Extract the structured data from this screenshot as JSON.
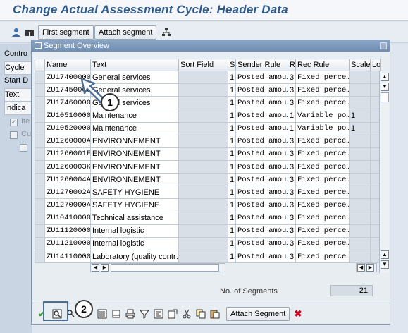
{
  "window": {
    "title": "Change Actual Assessment Cycle: Header Data"
  },
  "toolbar": {
    "icons": [
      "person-icon",
      "binoculars-icon"
    ],
    "first_segment_label": "First segment",
    "attach_segment_label": "Attach segment",
    "last_icon": "hierarchy-icon"
  },
  "left_panel": {
    "items": [
      "Contro",
      "Cycle",
      "Start D",
      "Text"
    ],
    "active_tab": "Indica",
    "checkbox_labels": [
      "Ite",
      "Cu"
    ]
  },
  "dialog": {
    "title": "Segment Overview",
    "columns": [
      "Name",
      "Text",
      "Sort Field",
      "S",
      "Sender Rule",
      "R",
      "Rec Rule",
      "Scale",
      "Lo"
    ],
    "rows": [
      {
        "name": "ZU17400000",
        "text": "General services",
        "sort": "",
        "s": "1",
        "sender_rule": "Posted amou…",
        "r": "3",
        "rec_rule": "Fixed perce…",
        "scale": ""
      },
      {
        "name": "ZU17450000",
        "text": "General services",
        "sort": "",
        "s": "1",
        "sender_rule": "Posted amou…",
        "r": "3",
        "rec_rule": "Fixed perce…",
        "scale": ""
      },
      {
        "name": "ZU17460000",
        "text": "General services",
        "sort": "",
        "s": "1",
        "sender_rule": "Posted amou…",
        "r": "3",
        "rec_rule": "Fixed perce…",
        "scale": ""
      },
      {
        "name": "ZU10510000",
        "text": "Maintenance",
        "sort": "",
        "s": "1",
        "sender_rule": "Posted amou…",
        "r": "1",
        "rec_rule": "Variable po…",
        "scale": "1"
      },
      {
        "name": "ZU10520000",
        "text": "Maintenance",
        "sort": "",
        "s": "1",
        "sender_rule": "Posted amou…",
        "r": "1",
        "rec_rule": "Variable po…",
        "scale": "1"
      },
      {
        "name": "ZU1260000A",
        "text": "ENVIRONNEMENT",
        "sort": "",
        "s": "1",
        "sender_rule": "Posted amou…",
        "r": "3",
        "rec_rule": "Fixed perce…",
        "scale": ""
      },
      {
        "name": "ZU1260001F",
        "text": "ENVIRONNEMENT",
        "sort": "",
        "s": "1",
        "sender_rule": "Posted amou…",
        "r": "3",
        "rec_rule": "Fixed perce…",
        "scale": ""
      },
      {
        "name": "ZU1260003K",
        "text": "ENVIRONNEMENT",
        "sort": "",
        "s": "1",
        "sender_rule": "Posted amou…",
        "r": "3",
        "rec_rule": "Fixed perce…",
        "scale": ""
      },
      {
        "name": "ZU1260004A",
        "text": "ENVIRONNEMENT",
        "sort": "",
        "s": "1",
        "sender_rule": "Posted amou…",
        "r": "3",
        "rec_rule": "Fixed perce…",
        "scale": ""
      },
      {
        "name": "ZU1270002A",
        "text": "SAFETY HYGIENE",
        "sort": "",
        "s": "1",
        "sender_rule": "Posted amou…",
        "r": "3",
        "rec_rule": "Fixed perce…",
        "scale": ""
      },
      {
        "name": "ZU1270000A",
        "text": "SAFETY HYGIENE",
        "sort": "",
        "s": "1",
        "sender_rule": "Posted amou…",
        "r": "3",
        "rec_rule": "Fixed perce…",
        "scale": ""
      },
      {
        "name": "ZU10410000",
        "text": "Technical assistance",
        "sort": "",
        "s": "1",
        "sender_rule": "Posted amou…",
        "r": "3",
        "rec_rule": "Fixed perce…",
        "scale": ""
      },
      {
        "name": "ZU11120000",
        "text": "Internal logistic",
        "sort": "",
        "s": "1",
        "sender_rule": "Posted amou…",
        "r": "3",
        "rec_rule": "Fixed perce…",
        "scale": ""
      },
      {
        "name": "ZU11210000",
        "text": "Internal logistic",
        "sort": "",
        "s": "1",
        "sender_rule": "Posted amou…",
        "r": "3",
        "rec_rule": "Fixed perce…",
        "scale": ""
      },
      {
        "name": "ZU14110000",
        "text": "Laboratory (quality contr…",
        "sort": "",
        "s": "1",
        "sender_rule": "Posted amou…",
        "r": "3",
        "rec_rule": "Fixed perce…",
        "scale": ""
      }
    ],
    "segment_count_label": "No. of Segments",
    "segment_count": "21",
    "attach_segment_button": "Attach Segment"
  },
  "callouts": {
    "step1": "1",
    "step2": "2"
  },
  "colors": {
    "title": "#2e5a8c",
    "dialog_header": "#7591b5",
    "callout_border": "#4d6e97",
    "cancel": "#d0021b",
    "confirm": "#2c9a2c"
  }
}
